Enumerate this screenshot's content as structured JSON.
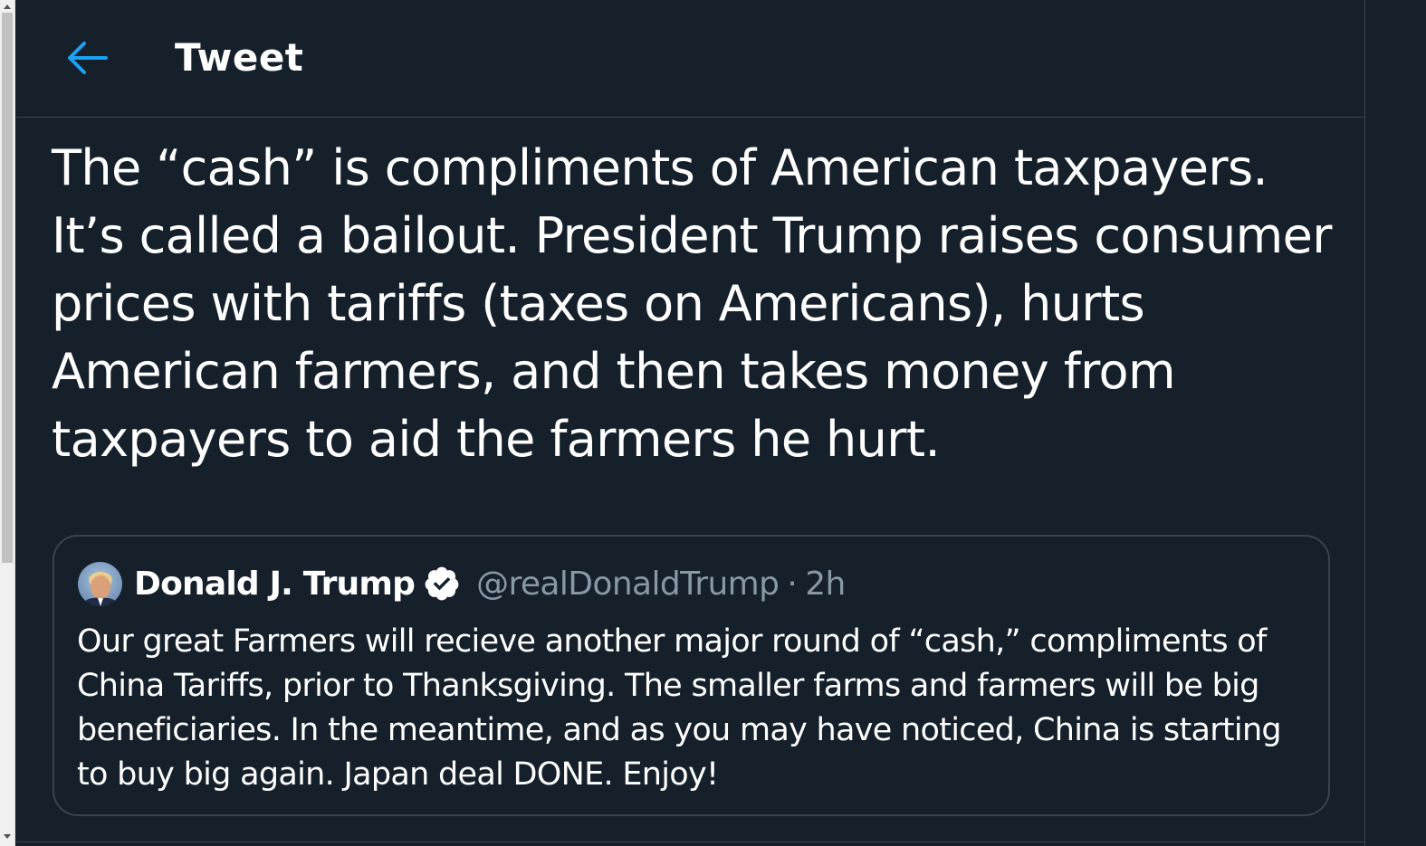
{
  "header": {
    "back_icon": "arrow-left-icon",
    "title": "Tweet"
  },
  "tweet": {
    "text": "The “cash” is compliments of American taxpayers. It’s called a bailout. President Trump raises consumer prices with tariffs (taxes on Americans), hurts American farmers, and then takes money from taxpayers to aid the farmers he hurt."
  },
  "quoted_tweet": {
    "author_name": "Donald J. Trump",
    "verified_icon": "verified-badge-icon",
    "handle": "@realDonaldTrump",
    "separator": "·",
    "timestamp": "2h",
    "text": "Our great Farmers will recieve another major round of “cash,” compliments of China Tariffs, prior to Thanksgiving. The smaller farms and farmers will be big beneficiaries. In the meantime, and as you may have noticed, China is starting to buy big again. Japan deal DONE. Enjoy!"
  },
  "colors": {
    "background": "#15202b",
    "accent": "#1da1f2",
    "border": "#38444d",
    "secondary_text": "#8899a6",
    "primary_text": "#ffffff"
  }
}
